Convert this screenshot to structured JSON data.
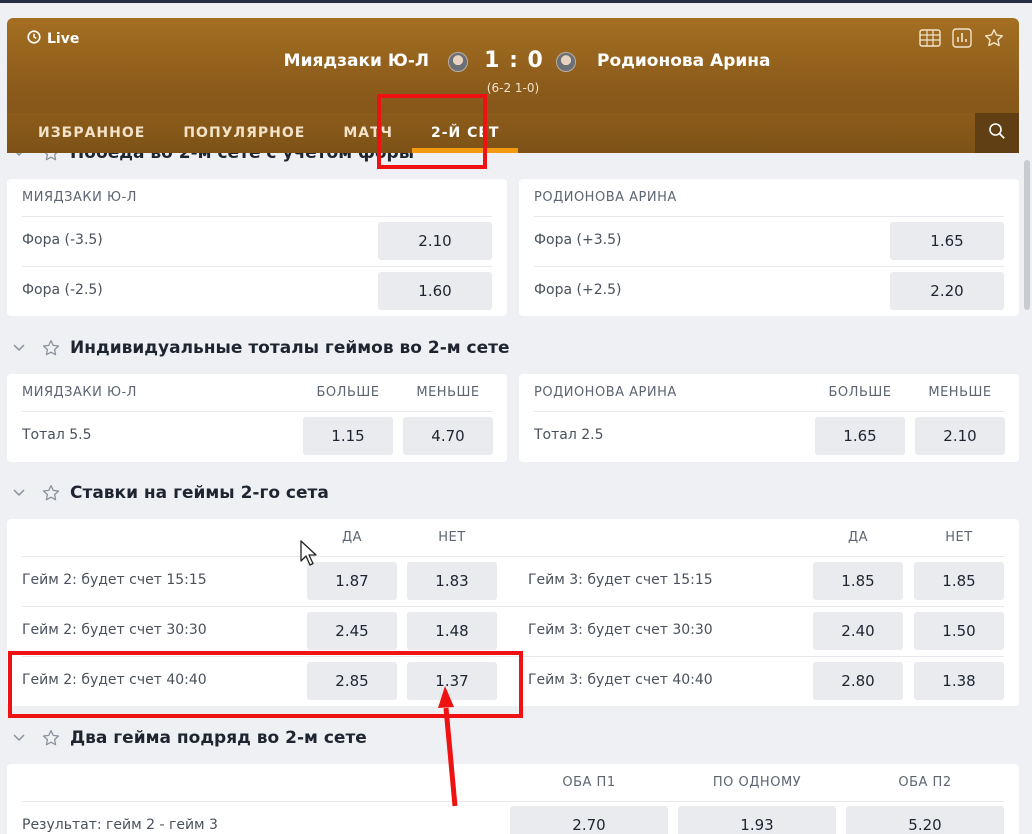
{
  "header": {
    "live_label": "Live",
    "team1": "Миядзаки Ю-Л",
    "team2": "Родионова Арина",
    "score": "1 : 0",
    "sets": "(6-2 1-0)",
    "icons": [
      "table-icon",
      "stats-icon",
      "star-icon"
    ],
    "tabs": [
      "ИЗБРАННОЕ",
      "ПОПУЛЯРНОЕ",
      "МАТЧ",
      "2-Й СЕТ"
    ],
    "active_tab": "2-Й СЕТ",
    "accent": "#f39a12"
  },
  "sec1": {
    "title": "Победа во 2-м сете с учетом форы",
    "left": {
      "head": "МИЯДЗАКИ Ю-Л",
      "rows": [
        {
          "label": "Фора (-3.5)",
          "odd": "2.10"
        },
        {
          "label": "Фора (-2.5)",
          "odd": "1.60"
        }
      ]
    },
    "right": {
      "head": "РОДИОНОВА АРИНА",
      "rows": [
        {
          "label": "Фора (+3.5)",
          "odd": "1.65"
        },
        {
          "label": "Фора (+2.5)",
          "odd": "2.20"
        }
      ]
    }
  },
  "sec2": {
    "title": "Индивидуальные тоталы геймов во 2-м сете",
    "left": {
      "head": "МИЯДЗАКИ Ю-Л",
      "col1": "БОЛЬШЕ",
      "col2": "МЕНЬШЕ",
      "label": "Тотал 5.5",
      "odd1": "1.15",
      "odd2": "4.70"
    },
    "right": {
      "head": "РОДИОНОВА АРИНА",
      "col1": "БОЛЬШЕ",
      "col2": "МЕНЬШЕ",
      "label": "Тотал 2.5",
      "odd1": "1.65",
      "odd2": "2.10"
    }
  },
  "sec3": {
    "title": "Ставки на геймы 2-го сета",
    "col_yes": "ДА",
    "col_no": "НЕТ",
    "left": [
      {
        "label": "Гейм 2: будет счет 15:15",
        "yes": "1.87",
        "no": "1.83"
      },
      {
        "label": "Гейм 2: будет счет 30:30",
        "yes": "2.45",
        "no": "1.48"
      },
      {
        "label": "Гейм 2: будет счет 40:40",
        "yes": "2.85",
        "no": "1.37"
      }
    ],
    "right": [
      {
        "label": "Гейм 3: будет счет 15:15",
        "yes": "1.85",
        "no": "1.85"
      },
      {
        "label": "Гейм 3: будет счет 30:30",
        "yes": "2.40",
        "no": "1.50"
      },
      {
        "label": "Гейм 3: будет счет 40:40",
        "yes": "2.80",
        "no": "1.38"
      }
    ]
  },
  "sec4": {
    "title": "Два гейма подряд во 2-м сете",
    "cols": [
      "ОБА П1",
      "ПО ОДНОМУ",
      "ОБА П2"
    ],
    "label": "Результат: гейм 2 - гейм 3",
    "odds": [
      "2.70",
      "1.93",
      "5.20"
    ]
  },
  "annotation_color": "#ee1212"
}
